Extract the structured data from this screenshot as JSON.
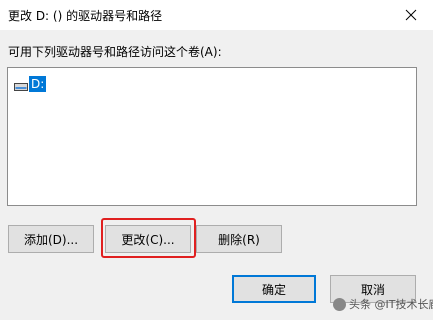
{
  "window": {
    "title": "更改 D: () 的驱动器号和路径",
    "close_glyph": "✕"
  },
  "instruction": "可用下列驱动器号和路径访问这个卷(A):",
  "drives": [
    {
      "label": "D:",
      "icon": "drive-icon",
      "selected": true
    }
  ],
  "buttons": {
    "add": "添加(D)...",
    "change": "更改(C)...",
    "delete": "删除(R)",
    "ok": "确定",
    "cancel": "取消"
  },
  "watermark": "头条 @IT技术长廊",
  "colors": {
    "selection": "#0078d7",
    "highlight_box": "#e02020",
    "default_button_border": "#0078d7"
  }
}
